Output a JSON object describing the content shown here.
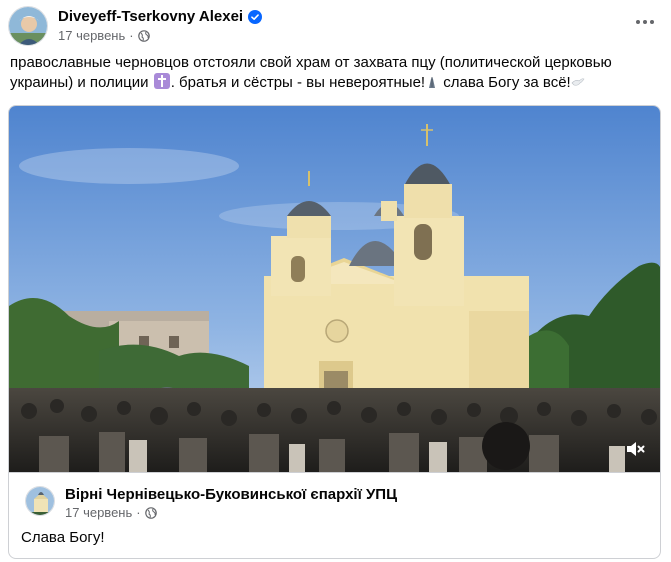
{
  "post": {
    "author": "Diveyeff-Tserkovny Alexei",
    "date": "17 червень",
    "dot": "·",
    "text_part1": "православные черновцов отстояли свой храм от захвата пцу (политической церковью украины) и полиции ",
    "text_part2": ". братья и сёстры - вы невероятные!",
    "text_part3": " слава Богу за всё!"
  },
  "shared": {
    "author": "Вірні Чернівецько-Буковинської єпархії УПЦ",
    "date": "17 червень",
    "dot": "·",
    "text": "Слава Богу!"
  },
  "icons": {
    "verified": "verified-badge-icon",
    "globe": "globe-icon",
    "more": "more-options-icon",
    "mute": "mute-icon",
    "cross": "orthodox-cross-icon",
    "prayer": "prayer-emoji-icon",
    "dove": "dove-emoji-icon"
  },
  "colors": {
    "verified": "#0866ff",
    "meta": "#65676b",
    "border": "#ced0d4"
  }
}
